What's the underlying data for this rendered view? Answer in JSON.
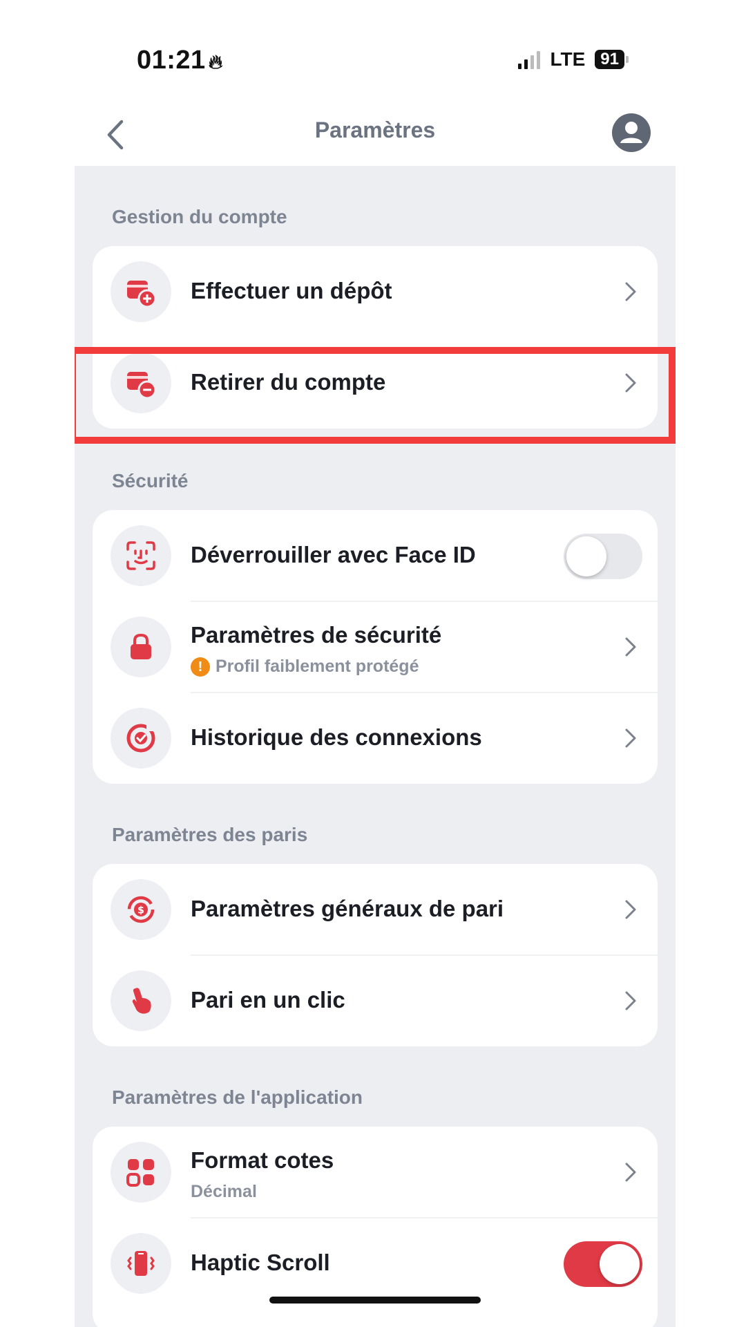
{
  "status_bar": {
    "time": "01:21",
    "network": "LTE",
    "battery": "91"
  },
  "nav": {
    "title": "Paramètres"
  },
  "sections": {
    "account": {
      "title": "Gestion du compte",
      "deposit": "Effectuer un dépôt",
      "withdraw": "Retirer du compte"
    },
    "security": {
      "title": "Sécurité",
      "face_id": "Déverrouiller avec Face ID",
      "face_id_enabled": false,
      "security_settings": "Paramètres de sécurité",
      "security_warning": "Profil faiblement protégé",
      "login_history": "Historique des connexions"
    },
    "betting": {
      "title": "Paramètres des paris",
      "general": "Paramètres généraux de pari",
      "one_click": "Pari en un clic"
    },
    "app": {
      "title": "Paramètres de l'application",
      "odds_format": "Format cotes",
      "odds_value": "Décimal",
      "haptic": "Haptic Scroll",
      "haptic_enabled": true
    }
  },
  "colors": {
    "accent": "#e03a46",
    "background": "#edeef2",
    "highlight": "#f23b3b",
    "warning": "#f08c16"
  }
}
